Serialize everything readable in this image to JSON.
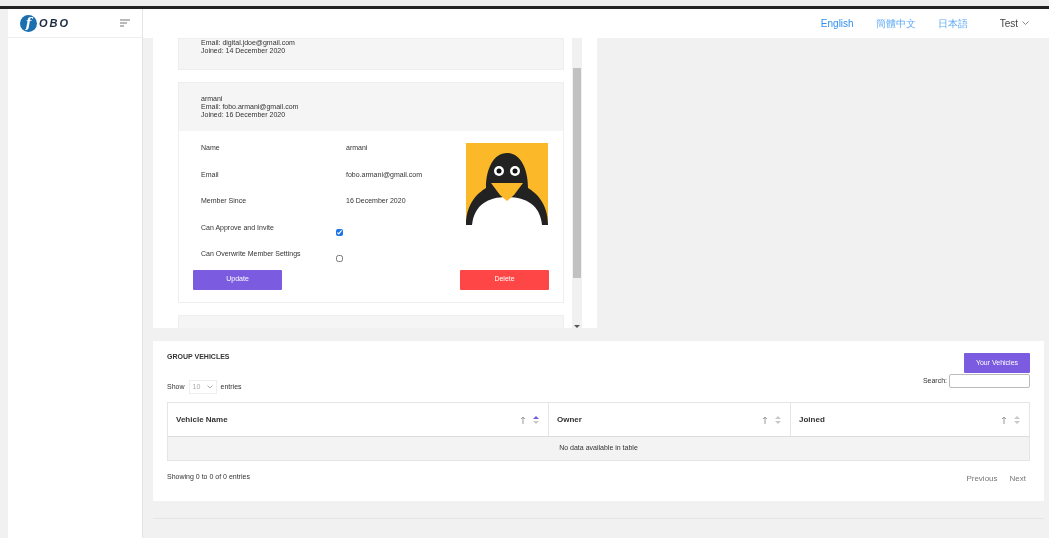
{
  "logo": {
    "mark": "f",
    "text": "OBO"
  },
  "header": {
    "languages": [
      {
        "label": "English",
        "selected": true
      },
      {
        "label": "簡體中文",
        "selected": false
      },
      {
        "label": "日本語",
        "selected": false
      }
    ],
    "user": "Test"
  },
  "members": [
    {
      "email": "Email: digital.jdoe@gmail.com",
      "joined": "Joined: 14 December 2020"
    },
    {
      "name": "armani",
      "email": "Email: fobo.armani@gmail.com",
      "joined": "Joined: 16 December 2020",
      "fields": [
        {
          "label": "Name",
          "value": "armani"
        },
        {
          "label": "Email",
          "value": "fobo.armani@gmail.com"
        },
        {
          "label": "Member Since",
          "value": "16 December 2020"
        }
      ],
      "permissions": [
        {
          "label": "Can Approve and Invite",
          "checked": true
        },
        {
          "label": "Can Overwrite Member Settings",
          "checked": false
        }
      ],
      "buttons": {
        "update": "Update",
        "delete": "Delete"
      }
    }
  ],
  "vehicles": {
    "title": "GROUP VEHICLES",
    "button": "Your Vehicles",
    "show": "Show",
    "page_size": "10",
    "entries": "entries",
    "search_label": "Search:",
    "columns": [
      {
        "label": "Vehicle Name",
        "sorted": true
      },
      {
        "label": "Owner",
        "sorted": false
      },
      {
        "label": "Joined",
        "sorted": false
      }
    ],
    "empty": "No data available in table",
    "info": "Showing 0 to 0 of 0 entries",
    "pagination": [
      "Previous",
      "Next"
    ]
  }
}
